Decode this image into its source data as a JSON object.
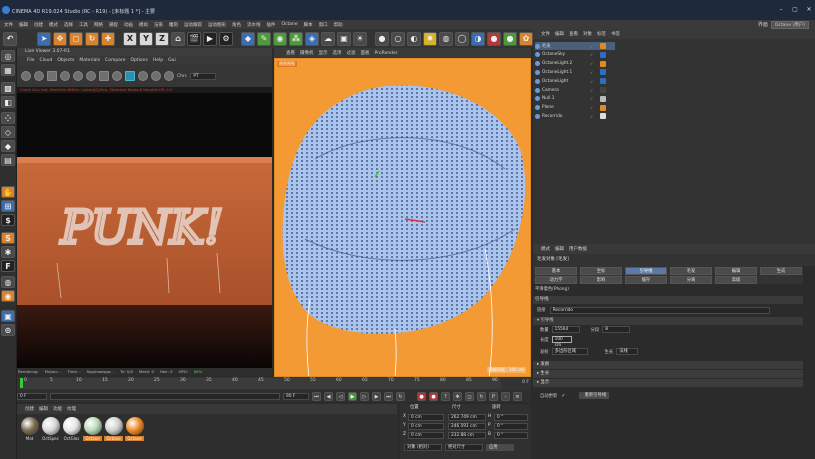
{
  "app": {
    "title": "CINEMA 4D R19.024 Studio (RC - R19) - [未标题 1 *] - 主要",
    "layout_label": "界面",
    "layout_value": "Octane (用户)"
  },
  "menubar": [
    "文件",
    "编辑",
    "创建",
    "模式",
    "选择",
    "工具",
    "网格",
    "捕捉",
    "动画",
    "模拟",
    "渲染",
    "雕刻",
    "运动跟踪",
    "运动图形",
    "角色",
    "流水线",
    "插件",
    "Octane",
    "脚本",
    "窗口",
    "帮助"
  ],
  "toolbar": {
    "x": "X",
    "y": "Y",
    "z": "Z"
  },
  "live_viewer": {
    "title": "Live Viewer 3.07-R1",
    "menu": [
      "File",
      "Cloud",
      "Objects",
      "Materials",
      "Compare",
      "Options",
      "Help",
      "Gui"
    ],
    "channel_label": "Chn:",
    "channel_value": "PT",
    "status": "Check Cou: Inst. MeshGen 468ms. Update[0]:0ms. Mesh:Inst Nodes:8 Movable:Off. 0:3",
    "render_text": "PUNK!",
    "footer": {
      "rendering": "Rendering:",
      "ms": "Ms/sec: -",
      "time": "Time: -",
      "spp": "Spp/maxspp: -",
      "tri": "Tri: 0/0",
      "mesh": "Mesh: 0",
      "hair": "Hair: 0",
      "gpu": "GPU:",
      "gpu_val": "86%"
    }
  },
  "viewport": {
    "menu": [
      "查看",
      "摄像机",
      "显示",
      "选项",
      "过滤",
      "面板",
      "ProRender"
    ],
    "label": "透视视图",
    "footer": "网格间距：100 cm"
  },
  "object_manager": {
    "menu": [
      "文件",
      "编辑",
      "查看",
      "对象",
      "标签",
      "书签"
    ],
    "items": [
      {
        "name": "毛发",
        "selected": true
      },
      {
        "name": "OctaneSky",
        "selected": false
      },
      {
        "name": "OctaneLight.2",
        "selected": false
      },
      {
        "name": "OctaneLight.1",
        "selected": false
      },
      {
        "name": "OctaneLight",
        "selected": false
      },
      {
        "name": "Camera",
        "selected": false
      },
      {
        "name": "Null.1",
        "selected": false
      },
      {
        "name": "Plane",
        "selected": false
      },
      {
        "name": "Recorrido",
        "selected": false
      }
    ]
  },
  "attribute_manager": {
    "menu": [
      "模式",
      "编辑",
      "用户数据"
    ],
    "header": "毛发对象 [毛发]",
    "tabs": [
      "基本",
      "坐标",
      "引导线",
      "毛发",
      "编辑",
      "生成",
      "动力学",
      "影响",
      "缓存",
      "分离",
      "高级",
      "平滑着色(Phong)"
    ],
    "active_tab": "引导线",
    "phong": "平滑着色(Phong)",
    "section": "引导线",
    "link_label": "链接",
    "link_value": "Recorrido",
    "count_label": "数量",
    "count_value": "15564",
    "seg_label": "分段",
    "seg_value": "8",
    "length_label": "长度",
    "length_value": "100 cm",
    "emit_label": "发射",
    "emit_value": "多边形区域",
    "origin_label": "生长",
    "origin_value": "法线",
    "sections": [
      "▸ 发根",
      "▸ 生长",
      "▸ 显示"
    ],
    "auto_update_label": "自动更新",
    "reload_button": "重新引导线"
  },
  "timeline": {
    "ticks": [
      "0",
      "5",
      "10",
      "15",
      "20",
      "25",
      "30",
      "35",
      "40",
      "45",
      "50",
      "55",
      "60",
      "65",
      "70",
      "75",
      "80",
      "85",
      "90"
    ],
    "current_frame": "0 F",
    "start": "0 F",
    "end": "90 F",
    "end2": "90 F",
    "fps_field": "0 F"
  },
  "material_manager": {
    "menu": [
      "创建",
      "编辑",
      "功能",
      "纹理"
    ],
    "materials": [
      {
        "label": "Mat",
        "color": "#7a6a50",
        "octane": false
      },
      {
        "label": "OctSpec",
        "color": "#d8d8d8",
        "octane": false
      },
      {
        "label": "OctGlos",
        "color": "#e5e5e5",
        "octane": false
      },
      {
        "label": "Octane",
        "color": "#b8d8b8",
        "octane": true
      },
      {
        "label": "Octane",
        "color": "#d0d0d0",
        "octane": true
      },
      {
        "label": "Octane",
        "color": "#f08a24",
        "octane": true
      }
    ]
  },
  "coordinates": {
    "headers": [
      "位置",
      "尺寸",
      "旋转"
    ],
    "rows": [
      {
        "axis": "X",
        "pos": "0 cm",
        "size": "262.749 cm",
        "rot_axis": "H",
        "rot": "0 °"
      },
      {
        "axis": "Y",
        "pos": "0 cm",
        "size": "246.591 cm",
        "rot_axis": "P",
        "rot": "0 °"
      },
      {
        "axis": "Z",
        "pos": "0 cm",
        "size": "232.88 cm",
        "rot_axis": "B",
        "rot": "0 °"
      }
    ],
    "mode": "对象 (相对)",
    "size_mode": "绝对尺寸",
    "apply": "应用"
  }
}
